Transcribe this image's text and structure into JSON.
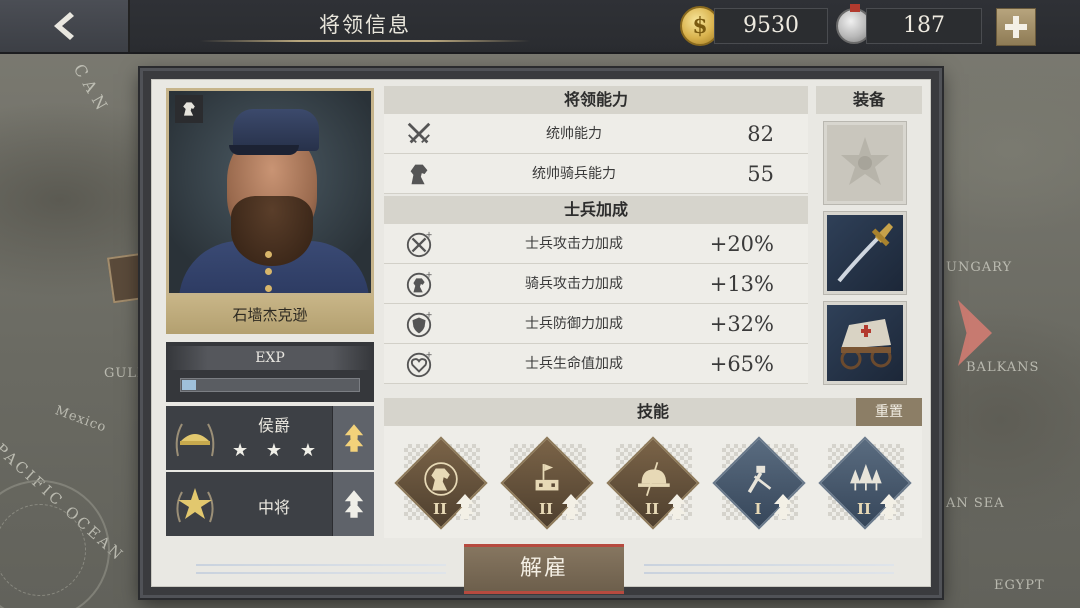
{
  "topbar": {
    "title": "将领信息",
    "gold": "9530",
    "medals": "187"
  },
  "map": {
    "labels": [
      "CAN",
      "GULF",
      "Mexico",
      "PACIFIC OCEAN",
      "UNGARY",
      "BALKANS",
      "AN SEA",
      "EGYPT"
    ]
  },
  "general": {
    "name": "石墙杰克逊",
    "exp_label": "EXP",
    "exp_progress": 0.08,
    "title_rank": "侯爵",
    "title_stars": 3,
    "military_rank": "中将"
  },
  "abilities": {
    "header": "将领能力",
    "items": [
      {
        "label": "统帅能力",
        "value": "82",
        "icon": "crossed-swords-icon"
      },
      {
        "label": "统帅骑兵能力",
        "value": "55",
        "icon": "horse-head-icon"
      }
    ]
  },
  "bonuses": {
    "header": "士兵加成",
    "items": [
      {
        "label": "士兵攻击力加成",
        "value": "+20%",
        "icon": "attack-plus-icon"
      },
      {
        "label": "骑兵攻击力加成",
        "value": "+13%",
        "icon": "cavalry-plus-icon"
      },
      {
        "label": "士兵防御力加成",
        "value": "+32%",
        "icon": "shield-plus-icon"
      },
      {
        "label": "士兵生命值加成",
        "value": "+65%",
        "icon": "heart-plus-icon"
      }
    ]
  },
  "equipment": {
    "header": "装备",
    "slots": [
      {
        "name": "medal-slot-icon",
        "state": "empty"
      },
      {
        "name": "saber-icon",
        "state": "equipped"
      },
      {
        "name": "ambulance-wagon-icon",
        "state": "equipped"
      }
    ]
  },
  "skills": {
    "header": "技能",
    "reset_label": "重置",
    "items": [
      {
        "icon": "cavalry-skill-icon",
        "level": "II",
        "color": "brown"
      },
      {
        "icon": "fortress-skill-icon",
        "level": "II",
        "color": "brown"
      },
      {
        "icon": "infantry-helmet-skill-icon",
        "level": "II",
        "color": "brown"
      },
      {
        "icon": "engineering-skill-icon",
        "level": "I",
        "color": "blue"
      },
      {
        "icon": "forest-skill-icon",
        "level": "II",
        "color": "blue"
      }
    ]
  },
  "actions": {
    "dismiss_label": "解雇"
  },
  "colors": {
    "gold_accent": "#c8b587",
    "dismiss_border": "#b64a3f",
    "upgrade_arrow": "#f3d27a",
    "panel_bg": "#e9e8e3"
  }
}
